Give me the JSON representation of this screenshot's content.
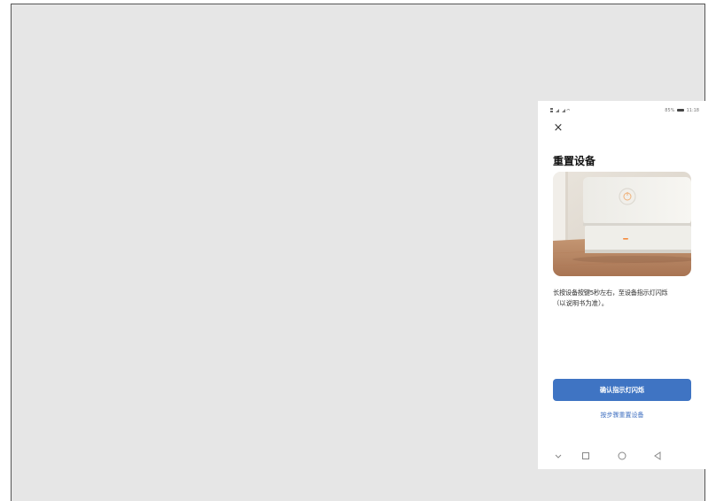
{
  "status_bar": {
    "signal": "4G 4G",
    "battery": "85%",
    "time": "11:18"
  },
  "dialog": {
    "title": "重置设备",
    "instruction_line1": "长按设备按键5秒左右，至设备指示灯闪烁",
    "instruction_line2": "（以说明书为准）。",
    "confirm_button": "确认指示灯闪烁",
    "step_link": "按步骤重置设备"
  },
  "icons": {
    "close": "close-icon",
    "nav_down": "chevron-down-icon",
    "nav_recent": "square-icon",
    "nav_home": "circle-icon",
    "nav_back": "triangle-back-icon"
  },
  "colors": {
    "primary": "#3f74c3",
    "link": "#3f6fc0",
    "backdrop": "#e6e6e6"
  }
}
